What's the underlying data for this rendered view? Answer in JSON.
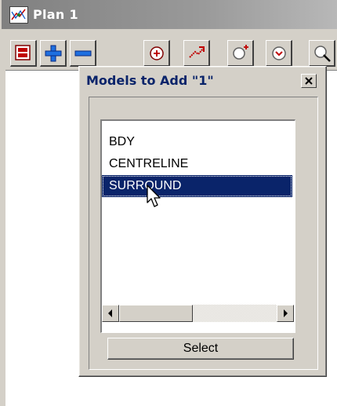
{
  "window": {
    "title": "Plan 1",
    "icon": "plan-view-icon"
  },
  "toolbar": {
    "buttons": [
      {
        "name": "layers-icon"
      },
      {
        "name": "add-model-icon"
      },
      {
        "name": "remove-model-icon"
      },
      {
        "name": "zoom-icon"
      },
      {
        "name": "pan-icon"
      },
      {
        "name": "zoom-window-icon"
      },
      {
        "name": "zoom-extent-icon"
      },
      {
        "name": "pick-icon"
      }
    ]
  },
  "dialog": {
    "title": "Models to Add \"1\"",
    "close_icon": "close-icon",
    "list": {
      "items": [
        "BDY",
        "CENTRELINE",
        "SURROUND"
      ],
      "selected_index": 2
    },
    "scrollbar": {
      "position": 0
    },
    "select_label": "Select"
  },
  "colors": {
    "selection": "#0a246a",
    "dialog_title": "#0a246a",
    "face": "#d4d0c8",
    "window_titlebar": "#808080"
  }
}
